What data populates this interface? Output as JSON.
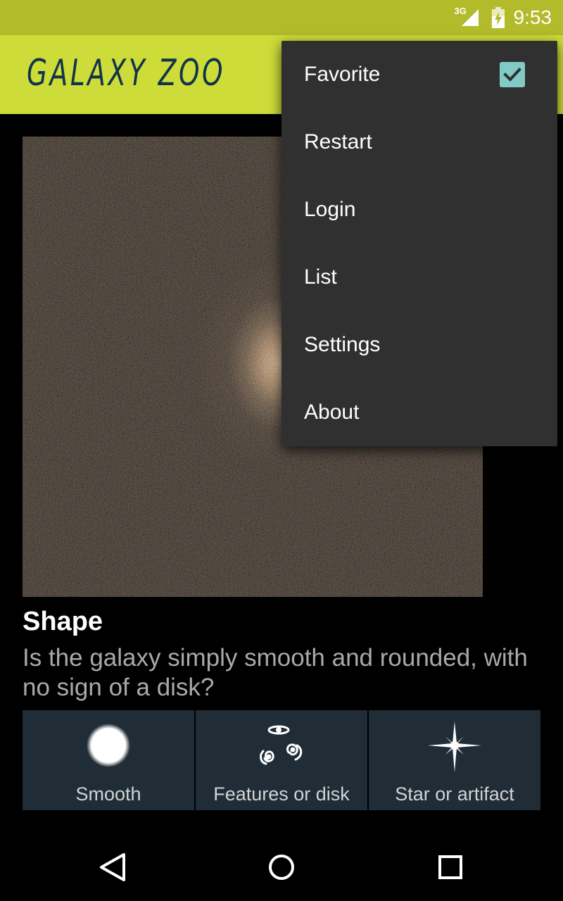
{
  "status_bar": {
    "network": "3G",
    "time": "9:53",
    "background_color": "#b2bb2a",
    "icons": [
      "signal-icon",
      "battery-charging-icon"
    ]
  },
  "app_bar": {
    "title": "GALAXY ZOO",
    "background_color": "#cddc39",
    "title_color": "#12344a"
  },
  "menu": {
    "items": [
      {
        "label": "Favorite",
        "checked": true
      },
      {
        "label": "Restart"
      },
      {
        "label": "Login"
      },
      {
        "label": "List"
      },
      {
        "label": "Settings"
      },
      {
        "label": "About"
      }
    ],
    "checkbox_color": "#80cbc4"
  },
  "question": {
    "title": "Shape",
    "text": "Is the galaxy simply smooth and rounded, with no sign of a disk?"
  },
  "answers": [
    {
      "label": "Smooth",
      "icon": "smooth-galaxy-icon"
    },
    {
      "label": "Features or disk",
      "icon": "spiral-galaxy-icon"
    },
    {
      "label": "Star or artifact",
      "icon": "star-icon"
    }
  ],
  "nav_bar": {
    "icons": [
      "back-icon",
      "home-icon",
      "recents-icon"
    ]
  }
}
